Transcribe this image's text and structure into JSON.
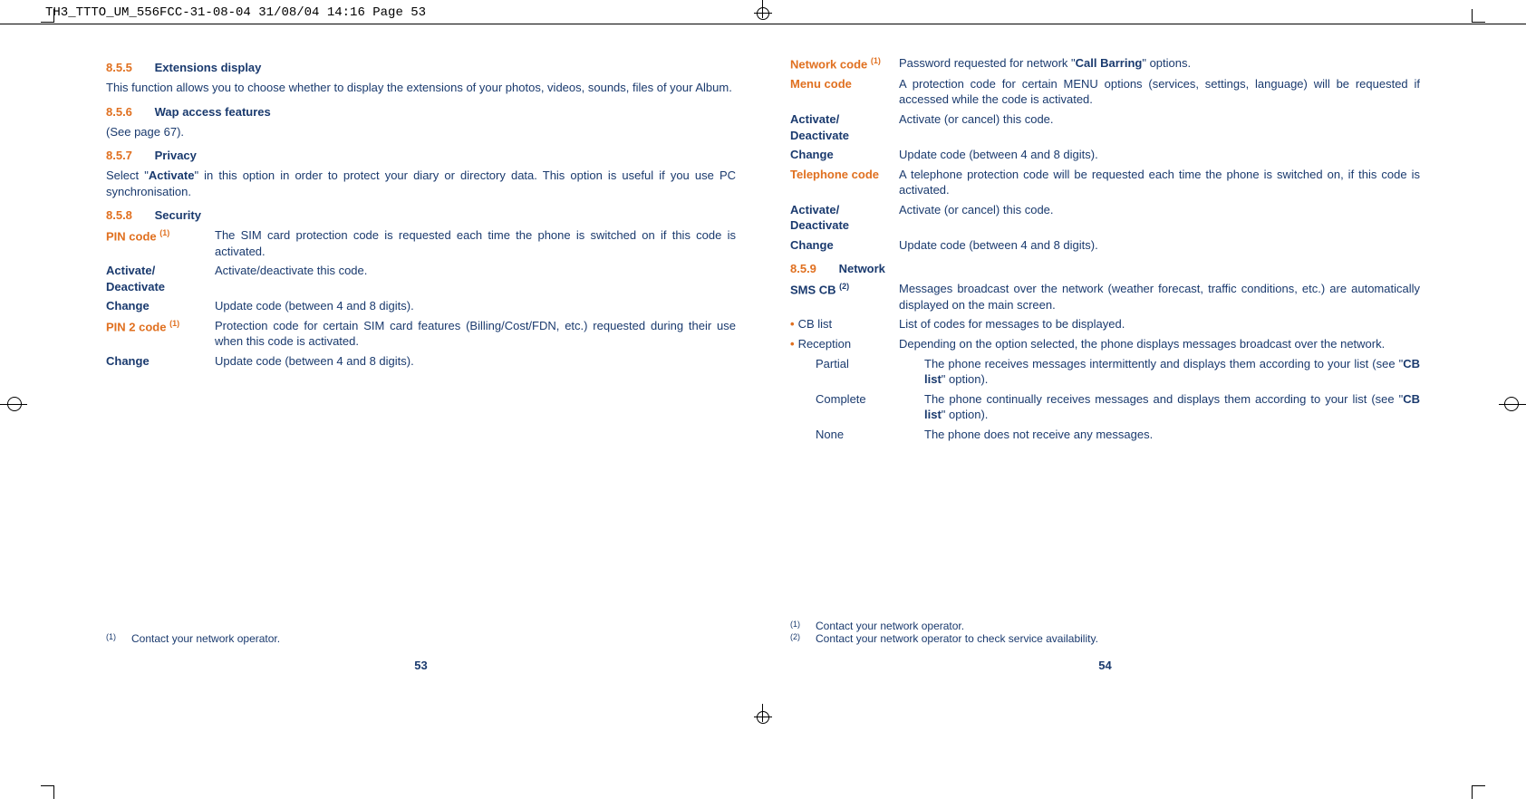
{
  "header": "TH3_TTTO_UM_556FCC-31-08-04  31/08/04  14:16  Page 53",
  "left": {
    "s855": {
      "num": "8.5.5",
      "title": "Extensions display",
      "body": "This function allows you to choose whether to display the extensions of your photos, videos, sounds, files of your Album."
    },
    "s856": {
      "num": "8.5.6",
      "title": "Wap access features",
      "body": "(See page 67)."
    },
    "s857": {
      "num": "8.5.7",
      "title": "Privacy",
      "body_pre": "Select \"",
      "body_bold": "Activate",
      "body_post": "\" in this option in order to protect your diary or directory data. This option is useful if you use PC synchronisation."
    },
    "s858": {
      "num": "8.5.8",
      "title": "Security"
    },
    "defs": [
      {
        "term": "PIN code ",
        "sup": "(1)",
        "orange": true,
        "desc": "The SIM card protection code is requested each time the phone is switched on if this code is activated."
      },
      {
        "term": "Activate/ Deactivate",
        "desc": "Activate/deactivate this code."
      },
      {
        "term": "Change",
        "desc": "Update code (between 4 and 8 digits)."
      },
      {
        "term": "PIN 2 code ",
        "sup": "(1)",
        "orange": true,
        "desc": "Protection code for certain SIM card features (Billing/Cost/FDN, etc.) requested during their use when this code is activated."
      },
      {
        "term": "Change",
        "desc": "Update code (between 4 and 8 digits)."
      }
    ],
    "footnotes": [
      {
        "sup": "(1)",
        "text": "Contact your network operator."
      }
    ],
    "pagenum": "53"
  },
  "right": {
    "defs1": [
      {
        "term": "Network code ",
        "sup": "(1)",
        "orange": true,
        "desc_pre": "Password requested for network \"",
        "desc_bold": "Call Barring",
        "desc_post": "\" options."
      },
      {
        "term": "Menu code",
        "orange": true,
        "desc": "A protection code for certain MENU options (services, settings, language) will be requested if accessed while the code is activated."
      },
      {
        "term": "Activate/ Deactivate",
        "desc": "Activate (or cancel) this code."
      },
      {
        "term": "Change",
        "desc": "Update code (between 4 and 8 digits)."
      },
      {
        "term": "Telephone code",
        "orange": true,
        "desc": "A telephone protection code will be requested each time the phone is switched on, if this code is activated."
      },
      {
        "term": "Activate/ Deactivate",
        "desc": "Activate (or cancel) this code."
      },
      {
        "term": "Change",
        "desc": "Update code (between 4 and 8 digits)."
      }
    ],
    "s859": {
      "num": "8.5.9",
      "title": "Network"
    },
    "defs2": [
      {
        "term": "SMS CB ",
        "sup": "(2)",
        "bold": true,
        "desc": "Messages broadcast over the network (weather forecast, traffic conditions, etc.) are automatically displayed on the main screen."
      },
      {
        "bullet": true,
        "term": "CB list",
        "desc": "List of codes for messages to be displayed."
      },
      {
        "bullet": true,
        "term": "Reception",
        "desc": "Depending on the option selected, the phone displays messages broadcast over the network."
      },
      {
        "indent": true,
        "term": "Partial",
        "desc_pre": "The phone receives messages intermittently and displays them according to your list (see \"",
        "desc_bold": "CB list",
        "desc_post": "\" option)."
      },
      {
        "indent": true,
        "term": "Complete",
        "desc_pre": "The phone continually receives messages and displays them according to your list (see \"",
        "desc_bold": "CB list",
        "desc_post": "\" option)."
      },
      {
        "indent": true,
        "term": "None",
        "desc": "The phone does not receive any messages."
      }
    ],
    "footnotes": [
      {
        "sup": "(1)",
        "text": "Contact your network operator."
      },
      {
        "sup": "(2)",
        "text": "Contact your network operator to check service availability."
      }
    ],
    "pagenum": "54"
  }
}
